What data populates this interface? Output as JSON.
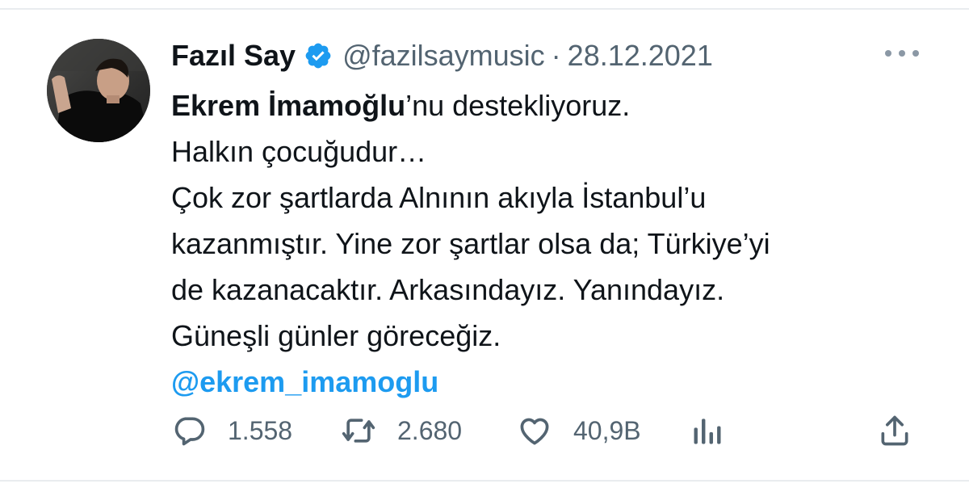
{
  "tweet": {
    "author": {
      "display_name": "Fazıl Say",
      "handle": "@fazilsaymusic",
      "verified": true,
      "avatar_icon": "profile-photo"
    },
    "separator": "·",
    "date": "28.12.2021",
    "more_icon": "more-horizontal-icon",
    "text": {
      "line1_bold": "Ekrem İmamoğlu",
      "line1_rest": "’nu destekliyoruz.",
      "line2": "Halkın çocuğudur…",
      "line3": "Çok zor şartlarda Alnının akıyla İstanbul’u",
      "line4": "kazanmıştır. Yine zor şartlar olsa da; Türkiye’yi",
      "line5": "de kazanacaktır. Arkasındayız. Yanındayız.",
      "line6": "Güneşli günler göreceğiz.",
      "mention": "@ekrem_imamoglu"
    },
    "actions": {
      "replies": "1.558",
      "retweets": "2.680",
      "likes": "40,9B"
    }
  },
  "colors": {
    "accent": "#1d9bf0",
    "muted": "#536471",
    "text": "#0f1419"
  }
}
